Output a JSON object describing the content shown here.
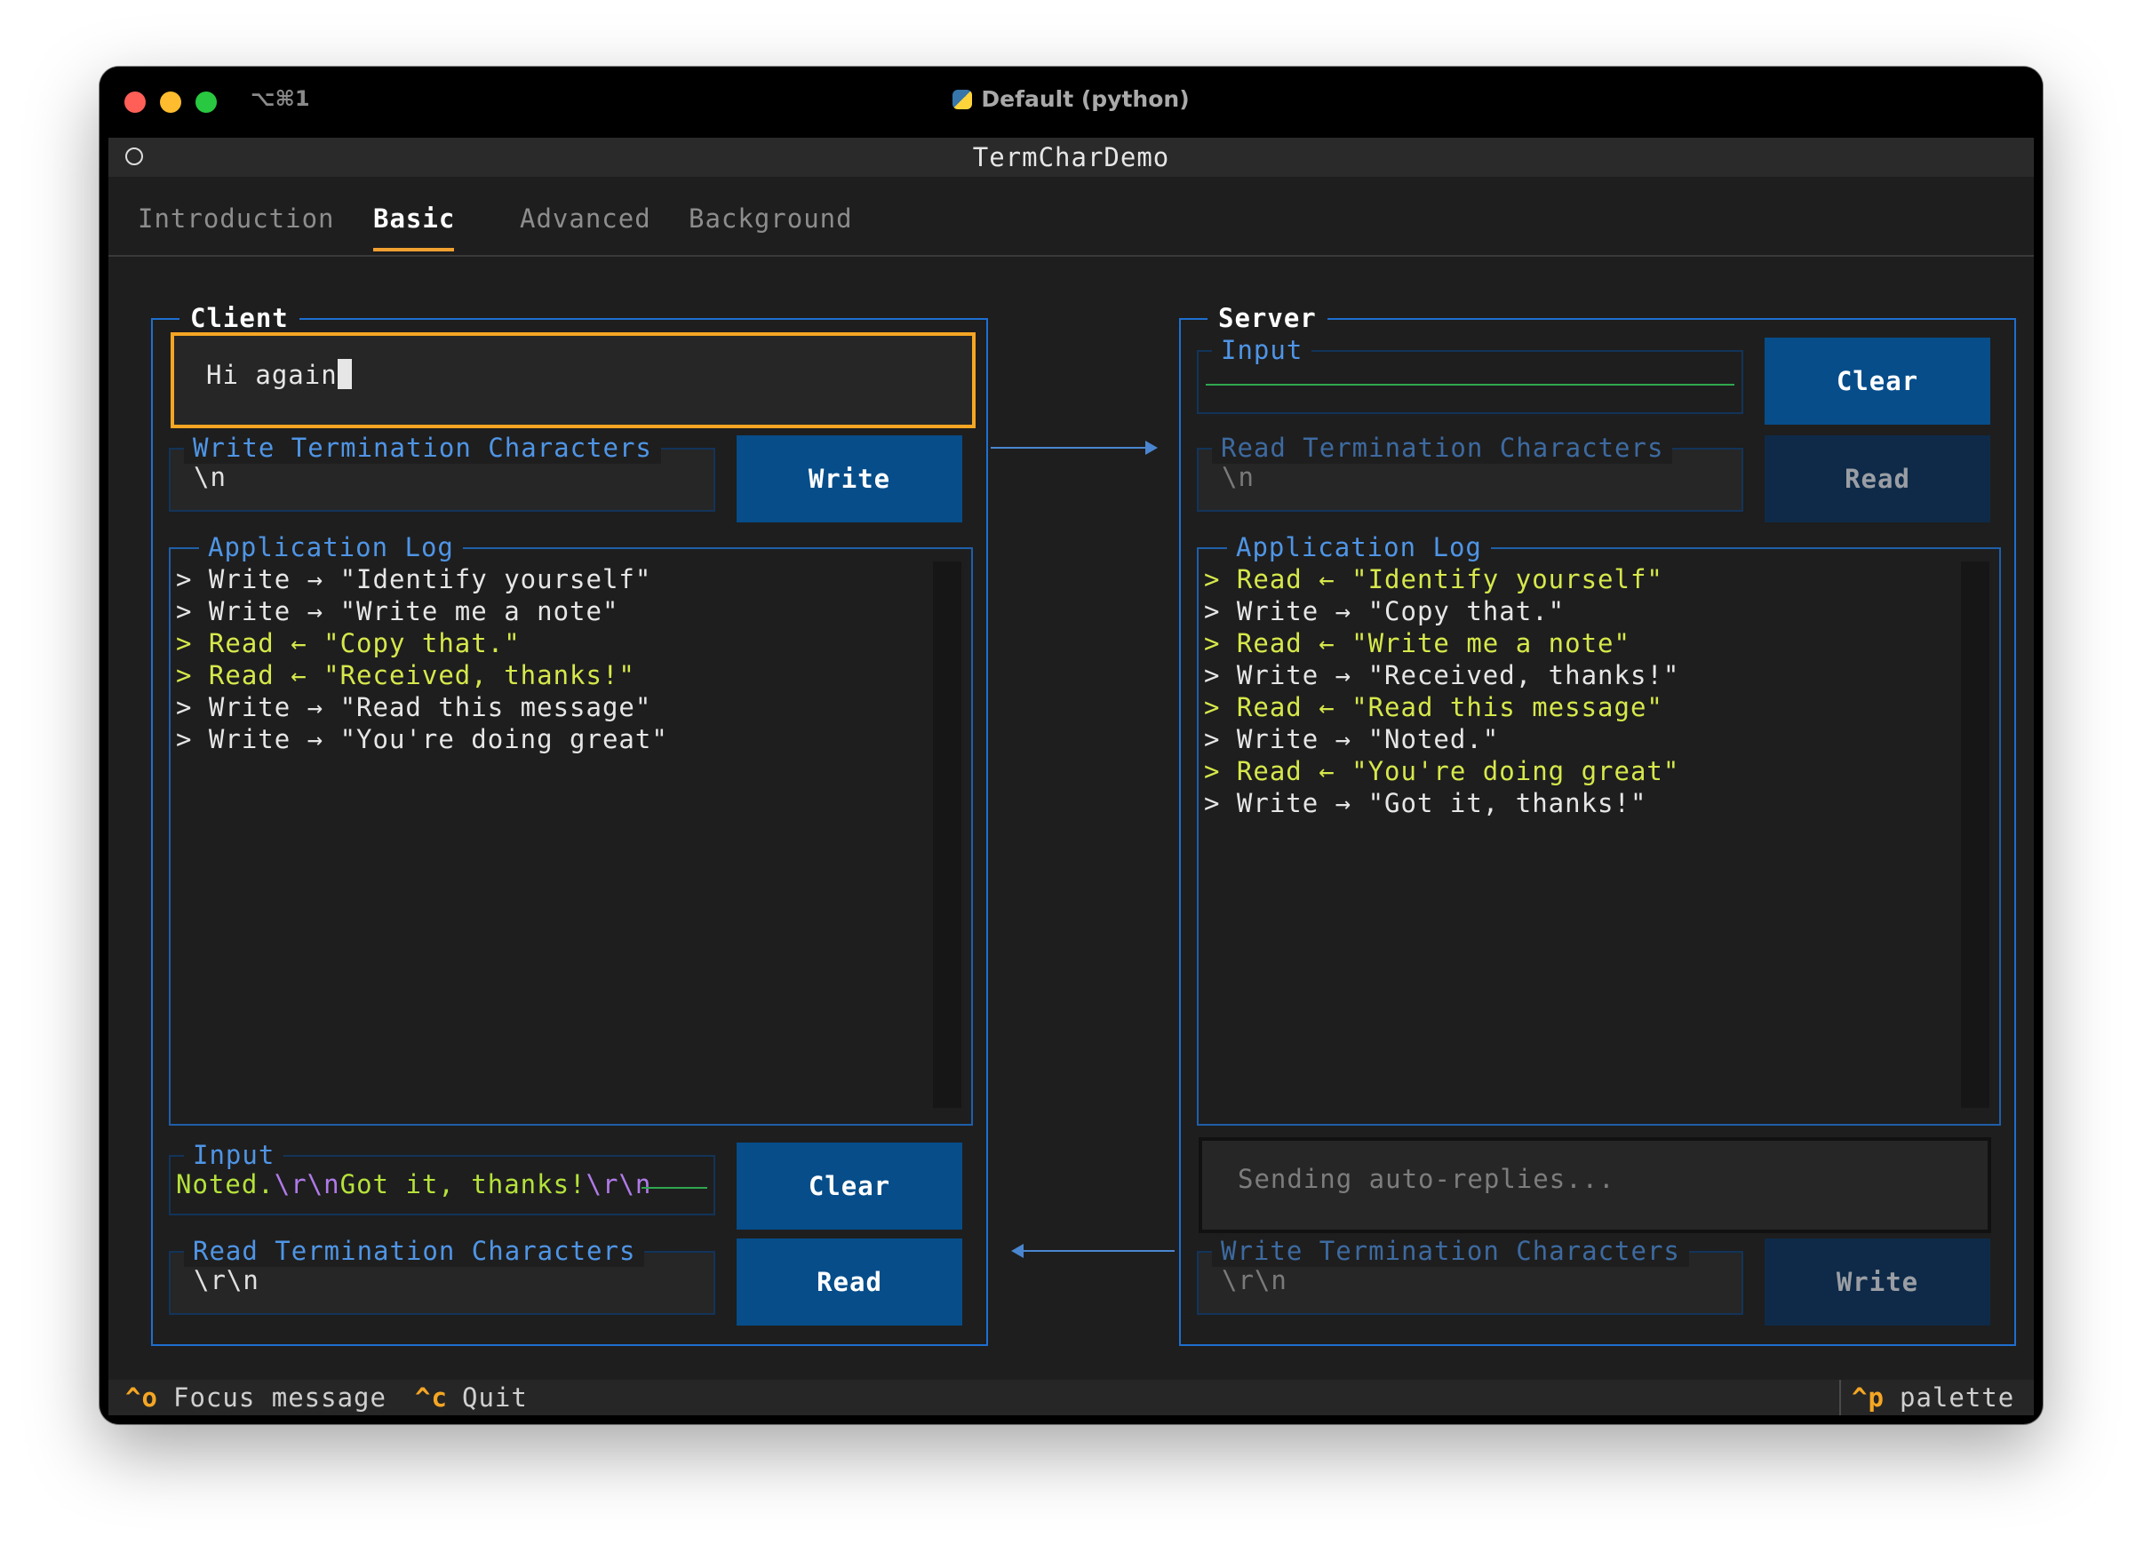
{
  "window": {
    "shortcut": "⌥⌘1",
    "title": "Default (python)"
  },
  "app": {
    "title": "TermCharDemo"
  },
  "tabs": [
    {
      "label": "Introduction",
      "active": false
    },
    {
      "label": "Basic",
      "active": true
    },
    {
      "label": "Advanced",
      "active": false
    },
    {
      "label": "Background",
      "active": false
    }
  ],
  "client": {
    "title": "Client",
    "message_input": "Hi again",
    "write_term": {
      "label": "Write Termination Characters",
      "value": "\\n"
    },
    "write_button": "Write",
    "log": {
      "label": "Application Log",
      "lines": [
        {
          "text": "> Write → \"Identify yourself\"",
          "kind": "write"
        },
        {
          "text": "> Write → \"Write me a note\"",
          "kind": "write"
        },
        {
          "text": "> Read ← \"Copy that.\"",
          "kind": "read"
        },
        {
          "text": "> Read ← \"Received, thanks!\"",
          "kind": "read"
        },
        {
          "text": "> Write → \"Read this message\"",
          "kind": "write"
        },
        {
          "text": "> Write → \"You're doing great\"",
          "kind": "write"
        }
      ]
    },
    "input": {
      "label": "Input",
      "parts": [
        "Noted.",
        "\\r\\n",
        "Got it, thanks!",
        "\\r\\n"
      ]
    },
    "clear_button": "Clear",
    "read_term": {
      "label": "Read Termination Characters",
      "value": "\\r\\n"
    },
    "read_button": "Read"
  },
  "server": {
    "title": "Server",
    "input": {
      "label": "Input",
      "value": ""
    },
    "clear_button": "Clear",
    "read_term": {
      "label": "Read Termination Characters",
      "value": "\\n"
    },
    "read_button": "Read",
    "log": {
      "label": "Application Log",
      "lines": [
        {
          "text": "> Read ← \"Identify yourself\"",
          "kind": "read"
        },
        {
          "text": "> Write → \"Copy that.\"",
          "kind": "write"
        },
        {
          "text": "> Read ← \"Write me a note\"",
          "kind": "read"
        },
        {
          "text": "> Write → \"Received, thanks!\"",
          "kind": "write"
        },
        {
          "text": "> Read ← \"Read this message\"",
          "kind": "read"
        },
        {
          "text": "> Write → \"Noted.\"",
          "kind": "write"
        },
        {
          "text": "> Read ← \"You're doing great\"",
          "kind": "read"
        },
        {
          "text": "> Write → \"Got it, thanks!\"",
          "kind": "write"
        }
      ]
    },
    "auto_reply": "Sending auto-replies...",
    "write_term": {
      "label": "Write Termination Characters",
      "value": "\\r\\n"
    },
    "write_button": "Write"
  },
  "footer": {
    "bindings": [
      {
        "key": "^o",
        "label": "Focus message"
      },
      {
        "key": "^c",
        "label": "Quit"
      }
    ],
    "palette": {
      "key": "^p",
      "label": "palette"
    }
  },
  "colors": {
    "accent": "#f5a623",
    "border": "#1e6fd0",
    "button": "#064d8a",
    "button_dim": "#0e2a48",
    "read_text": "#d6e84b",
    "label": "#4f95e6"
  },
  "icons": {
    "python": "python-icon"
  }
}
